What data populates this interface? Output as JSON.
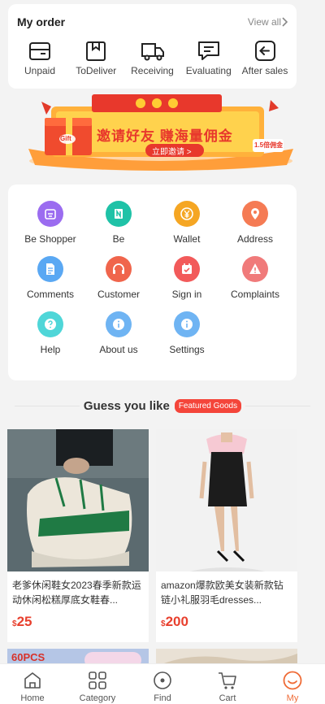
{
  "order": {
    "title": "My order",
    "view_all": "View all",
    "items": [
      {
        "label": "Unpaid",
        "icon": "wallet-icon"
      },
      {
        "label": "ToDeliver",
        "icon": "package-icon"
      },
      {
        "label": "Receiving",
        "icon": "truck-icon"
      },
      {
        "label": "Evaluating",
        "icon": "comment-icon"
      },
      {
        "label": "After sales",
        "icon": "return-icon"
      }
    ]
  },
  "banner": {
    "headline": "邀请好友 赚海量佣金",
    "cta": "立即邀请 >",
    "badge": "1.5倍佣金",
    "gift_label": "Gift"
  },
  "services": {
    "items": [
      {
        "label": "Be Shopper",
        "icon": "shop-icon",
        "color": "#9b6cf0"
      },
      {
        "label": "Be",
        "icon": "n-badge-icon",
        "color": "#1fc2a7"
      },
      {
        "label": "Wallet",
        "icon": "yen-icon",
        "color": "#f5a623"
      },
      {
        "label": "Address",
        "icon": "location-pin-icon",
        "color": "#f57b54"
      },
      {
        "label": "Comments",
        "icon": "document-icon",
        "color": "#5aa8f3"
      },
      {
        "label": "Customer",
        "icon": "headset-icon",
        "color": "#f0654c"
      },
      {
        "label": "Sign in",
        "icon": "calendar-check-icon",
        "color": "#f25a5a"
      },
      {
        "label": "Complaints",
        "icon": "warning-icon",
        "color": "#f07a7a"
      },
      {
        "label": "Help",
        "icon": "question-icon",
        "color": "#4fd6d8"
      },
      {
        "label": "About us",
        "icon": "info-icon",
        "color": "#6fb4f3"
      },
      {
        "label": "Settings",
        "icon": "info-icon",
        "color": "#6fb4f3"
      }
    ]
  },
  "guess": {
    "title": "Guess you like",
    "tag": "Featured Goods"
  },
  "products": [
    {
      "title": "老爹休闲鞋女2023春季新款运动休闲松糕厚底女鞋春...",
      "currency": "$",
      "price": "25"
    },
    {
      "title": "amazon爆款欧美女装新款钻链小礼服羽毛dresses...",
      "currency": "$",
      "price": "200"
    }
  ],
  "peek": {
    "left_text": "60PCS"
  },
  "tabbar": {
    "items": [
      {
        "label": "Home",
        "icon": "home-icon"
      },
      {
        "label": "Category",
        "icon": "grid-icon"
      },
      {
        "label": "Find",
        "icon": "compass-icon"
      },
      {
        "label": "Cart",
        "icon": "cart-icon"
      },
      {
        "label": "My",
        "icon": "smile-icon"
      }
    ],
    "active": "My",
    "active_color": "#ef6b36"
  }
}
